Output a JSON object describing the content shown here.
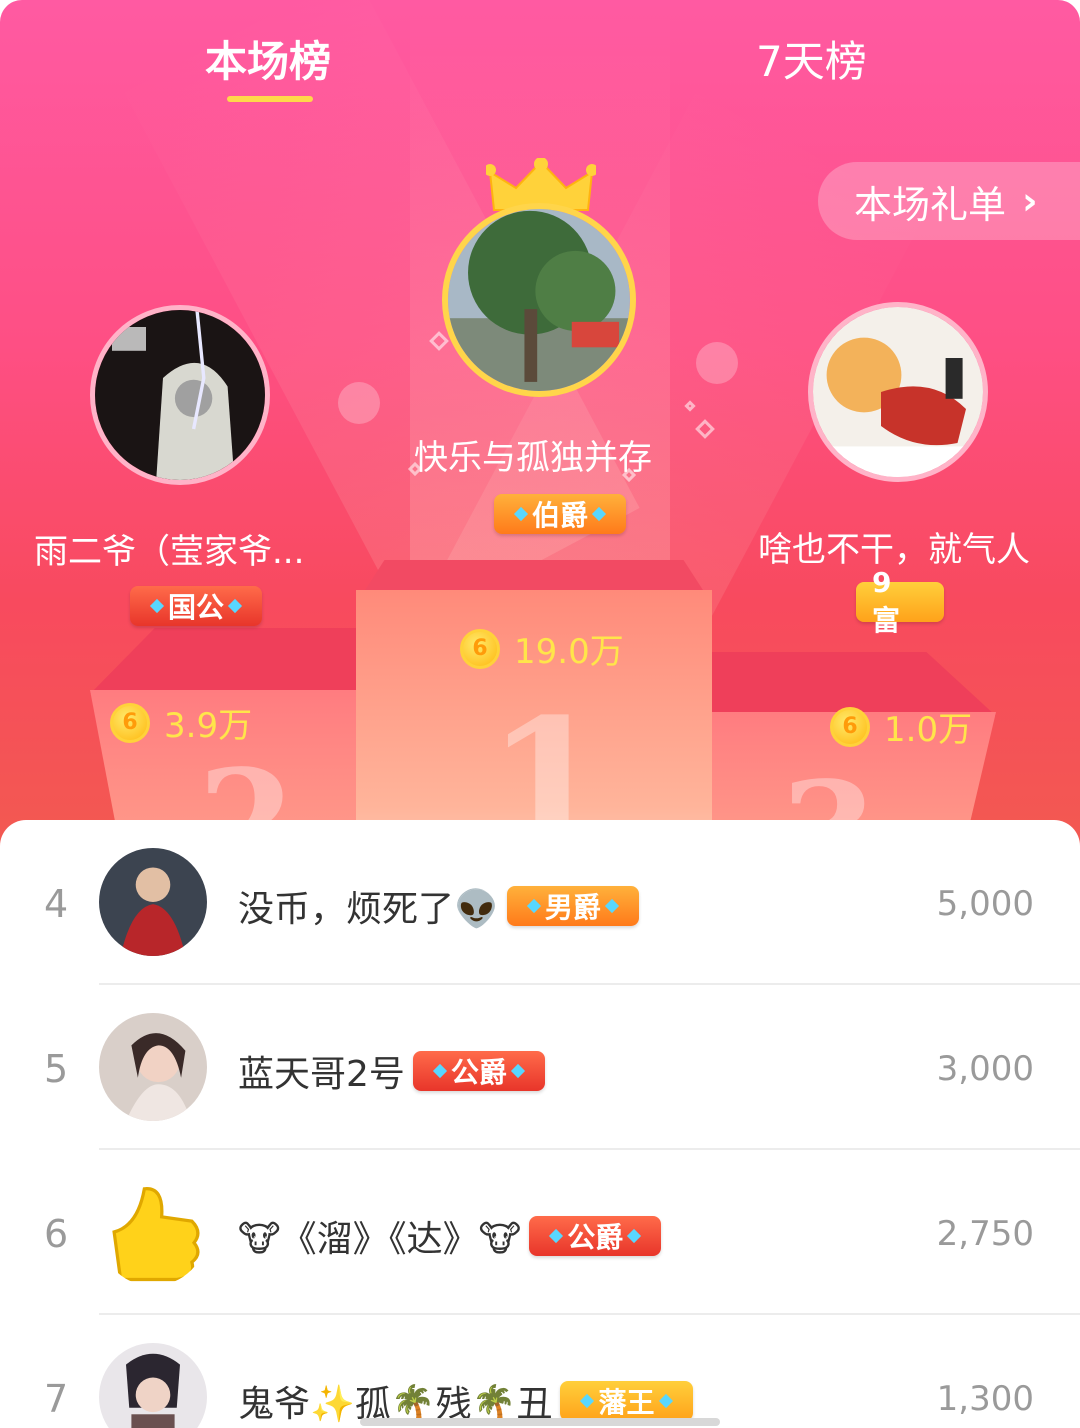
{
  "tabs": [
    {
      "label": "本场榜",
      "active": true
    },
    {
      "label": "7天榜",
      "active": false
    }
  ],
  "gift_list_button": {
    "label": "本场礼单",
    "chevron": "›"
  },
  "podium": {
    "first": {
      "rank": "1",
      "name": "快乐与孤独并存",
      "badge": "伯爵",
      "score": "19.0万"
    },
    "second": {
      "rank": "2",
      "name": "雨二爷（莹家爷...",
      "badge": "国公",
      "score": "3.9万"
    },
    "third": {
      "rank": "3",
      "name": "啥也不干，就气人",
      "badge": "9 富",
      "score": "1.0万"
    }
  },
  "coin_glyph": "6",
  "list": [
    {
      "rank": "4",
      "name": "没币，烦死了👽",
      "badge": "男爵",
      "badge_style": "orange",
      "value": "5,000"
    },
    {
      "rank": "5",
      "name": "蓝天哥2号",
      "badge": "公爵",
      "badge_style": "red",
      "value": "3,000"
    },
    {
      "rank": "6",
      "name": "🐮《溜》《达》🐮",
      "badge": "公爵",
      "badge_style": "red",
      "value": "2,750"
    },
    {
      "rank": "7",
      "name": "鬼爷✨孤🌴残🌴丑",
      "badge": "藩王",
      "badge_style": "gold",
      "value": "1,300"
    }
  ],
  "colors": {
    "header_gradient_top": "#ff5aa2",
    "header_gradient_bottom": "#f25a50",
    "tab_underline": "#ffd84a",
    "score_text": "#ffe54a"
  }
}
